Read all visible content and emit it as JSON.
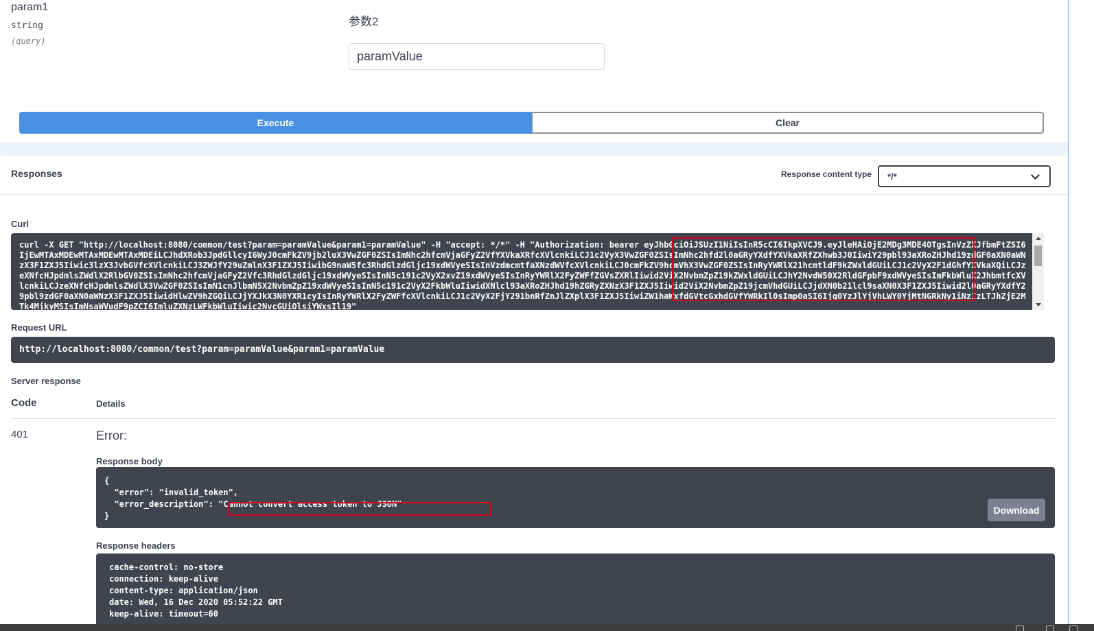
{
  "parameter": {
    "name": "param1",
    "type": "string",
    "in": "(query)",
    "description": "参数2",
    "value": "paramValue"
  },
  "actions": {
    "execute_label": "Execute",
    "clear_label": "Clear"
  },
  "responses": {
    "title": "Responses",
    "content_type_label": "Response content type",
    "content_type_value": "*/*"
  },
  "curl": {
    "label": "Curl",
    "command": "curl -X GET \"http://localhost:8080/common/test?param=paramValue&param1=paramValue\" -H \"accept: */*\" -H \"Authorization: bearer eyJhbGciOiJSUzI1NiIsInR5cCI6IkpXVCJ9.eyJleHAiOjE2MDg3MDE4OTgsInVzZXJfbmFtZSI6IjEwMTAxMDEwMTAxMDEwMTAxMDEiLCJhdXRob3JpdGllcyI6WyJ0cmFkZV9jb2luX3VwZGF0ZSIsImNhc2hfcmVjaGFyZ2VfYXVkaXRfcXVlcnkiLCJ1c2VyX3VwZGF0ZSIsImNhc2hfd2l0aGRyYXdfYXVkaXRfZXhwb3J0IiwiY29pbl93aXRoZHJhd19zdGF0aXN0aWNzX3F1ZXJ5Iiwic3lzX3JvbGVfcXVlcnkiLCJ3ZWJfY29uZmlnX3F1ZXJ5IiwibG9naW5fc3RhdGlzdGljc19xdWVyeSIsInVzdmcmtfaXNzdWVfcXVlcnkiLCJ0cmFkZV9hcmVhX3VwZGF0ZSIsInRyYWRlX21hcmtldF9kZWxldGUiLCJ1c2VyX2F1dGhfYXVkaXQiLCJzeXNfcHJpdmlsZWdlX2RlbGV0ZSIsImNhc2hfcmVjaGFyZ2Vfc3RhdGlzdGljc19xdWVyeSIsInN5c191c2VyX2xvZ19xdWVyeSIsInRyYWRlX2FyZWFfZGVsZXRlIiwid2ViX2NvbmZpZ19kZWxldGUiLCJhY2NvdW50X2RldGFpbF9xdWVyeSIsImFkbWluX2JhbmtfcXVlcnkiLCJzeXNfcHJpdmlsZWdlX3VwZGF0ZSIsImN1cnJlbmN5X2NvbmZpZ19xdWVyeSIsInN5c191c2VyX2FkbWluIiwidXNlcl93aXRoZHJhd19hZGRyZXNzX3F1ZXJ5Iiwid2ViX2NvbmZpZ19jcmVhdGUiLCJjdXN0b21lcl9saXN0X3F1ZXJ5Iiwid2l0aGRyYXdfY29pbl9zdGF0aXN0aWNzX3F1ZXJ5IiwidHlwZV9hZGQiLCJjYXJkX3N0YXR1cyIsInRyYWRlX2FyZWFfcXVlcnkiLCJ1c2VyX2FjY291bnRfZnJlZXplX3F1ZXJ5IiwiZW1haWxfdGVtcGxhdGVfYWRkIl0sImp0aSI6Ijg0YzJlYjVhLWY0YjMtNGRkNy1iNzIzLTJhZjE2MTk4MjkyMSIsImNsaWVudF9pZCI6ImluZXNzLWFkbWluIiwic2NvcGUiOlsiYWxsIl19\""
  },
  "request_url": {
    "label": "Request URL",
    "value": "http://localhost:8080/common/test?param=paramValue&param1=paramValue"
  },
  "server_response": {
    "label": "Server response",
    "code_header": "Code",
    "details_header": "Details",
    "code": "401",
    "error_title": "Error:",
    "body_label": "Response body",
    "body_lines": [
      "{",
      "  \"error\": \"invalid_token\",",
      "  \"error_description\": \"Cannot convert access token to JSON\"",
      "}"
    ],
    "download_label": "Download",
    "headers_label": "Response headers",
    "header_lines": [
      "cache-control: no-store",
      "connection: keep-alive",
      "content-type: application/json",
      "date: Wed, 16 Dec 2020 05:52:22 GMT",
      "keep-alive: timeout=60"
    ]
  },
  "colors": {
    "execute": "#4990e2",
    "code_bg": "#41444e",
    "highlight": "#d0021b"
  }
}
